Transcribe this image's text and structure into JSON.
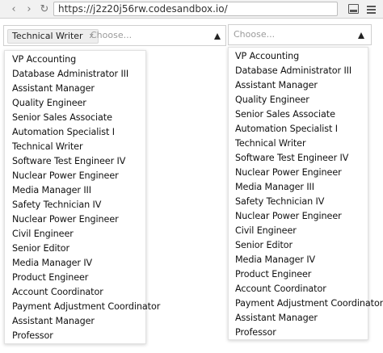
{
  "browser": {
    "url": "https://j2z20j56rw.codesandbox.io/",
    "icons": [
      "back-arrow-icon",
      "forward-arrow-icon",
      "reload-icon",
      "panel-icon",
      "menu-icon"
    ]
  },
  "left_select": {
    "selected_chip": "Technical Writer",
    "chip_remove": "x",
    "placeholder": "Choose...",
    "options": [
      "VP Accounting",
      "Database Administrator III",
      "Assistant Manager",
      "Quality Engineer",
      "Senior Sales Associate",
      "Automation Specialist I",
      "Technical Writer",
      "Software Test Engineer IV",
      "Nuclear Power Engineer",
      "Media Manager III",
      "Safety Technician IV",
      "Nuclear Power Engineer",
      "Civil Engineer",
      "Senior Editor",
      "Media Manager IV",
      "Product Engineer",
      "Account Coordinator",
      "Payment Adjustment Coordinator",
      "Assistant Manager",
      "Professor"
    ]
  },
  "right_select": {
    "placeholder": "Choose...",
    "options": [
      "VP Accounting",
      "Database Administrator III",
      "Assistant Manager",
      "Quality Engineer",
      "Senior Sales Associate",
      "Automation Specialist I",
      "Technical Writer",
      "Software Test Engineer IV",
      "Nuclear Power Engineer",
      "Media Manager III",
      "Safety Technician IV",
      "Nuclear Power Engineer",
      "Civil Engineer",
      "Senior Editor",
      "Media Manager IV",
      "Product Engineer",
      "Account Coordinator",
      "Payment Adjustment Coordinator",
      "Assistant Manager",
      "Professor"
    ]
  }
}
